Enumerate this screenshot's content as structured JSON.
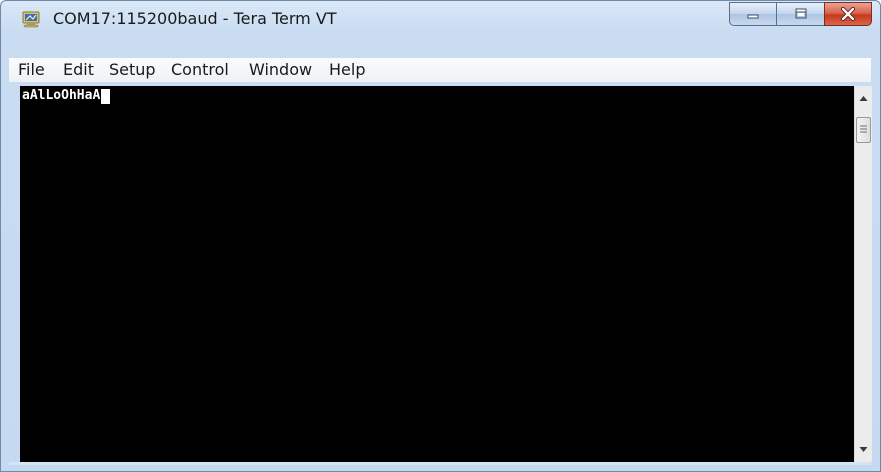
{
  "window": {
    "title": "COM17:115200baud - Tera Term VT"
  },
  "menu": {
    "items": [
      {
        "label": "File"
      },
      {
        "label": "Edit"
      },
      {
        "label": "Setup"
      },
      {
        "label": "Control"
      },
      {
        "label": "Window"
      },
      {
        "label": "Help"
      }
    ]
  },
  "terminal": {
    "output_text": "aAlLoOhHaA",
    "background_color": "#000000",
    "text_color": "#ffffff"
  },
  "icons": {
    "app": "tera-term-icon",
    "minimize": "minimize-icon",
    "maximize": "maximize-icon",
    "close": "close-icon",
    "scroll_up": "scroll-up-arrow-icon",
    "scroll_down": "scroll-down-arrow-icon"
  }
}
